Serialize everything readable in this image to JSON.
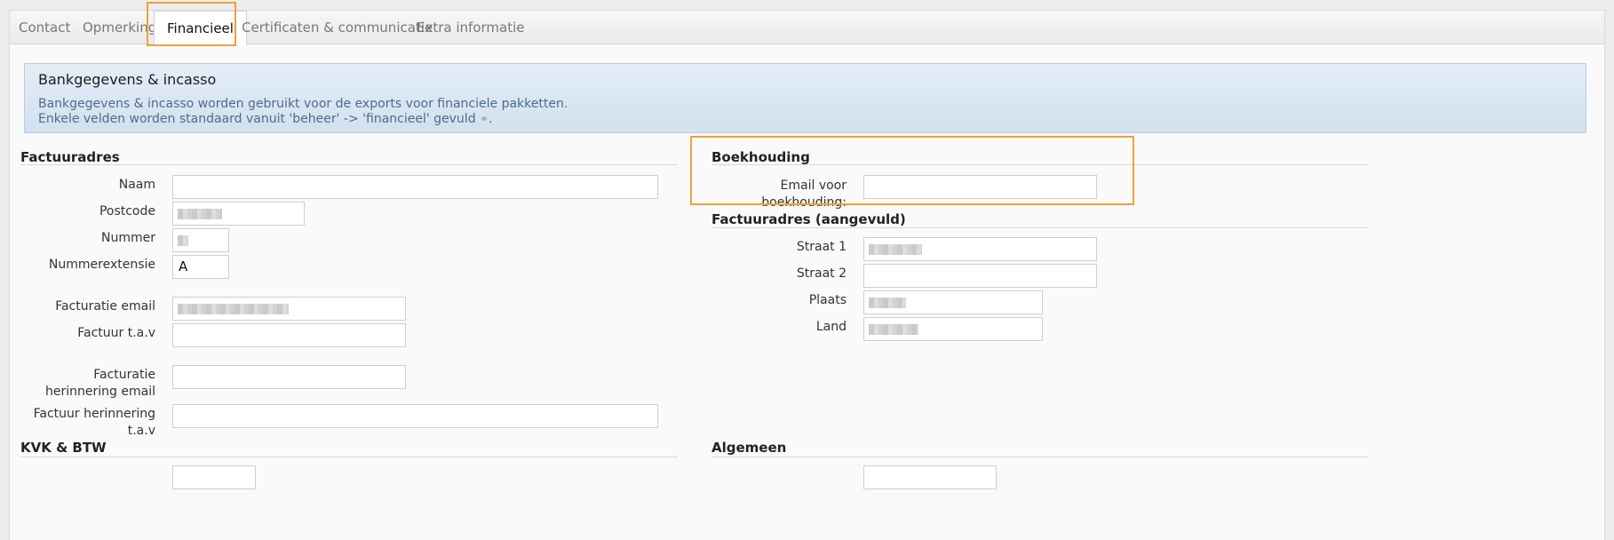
{
  "tabs": [
    {
      "label": "Contact",
      "active": false
    },
    {
      "label": "Opmerking",
      "active": false
    },
    {
      "label": "Financieel",
      "active": true
    },
    {
      "label": "Certificaten & communicatie",
      "active": false
    },
    {
      "label": "Extra informatie",
      "active": false
    }
  ],
  "info": {
    "title": "Bankgegevens & incasso",
    "line1": "Bankgegevens & incasso worden gebruikt voor de exports voor financiele pakketten.",
    "line2": "Enkele velden worden standaard vanuit 'beheer' -> 'financieel' gevuld",
    "line2_end": ".",
    "link_icon": "link-icon"
  },
  "factuuradres": {
    "title": "Factuuradres",
    "naam_label": "Naam",
    "postcode_label": "Postcode",
    "nummer_label": "Nummer",
    "nummerextensie_label": "Nummerextensie",
    "nummerextensie_value": "A",
    "facturatie_email_label": "Facturatie email",
    "factuur_tav_label": "Factuur t.a.v",
    "herinnering_email_label": "Facturatie herinnering email",
    "herinnering_tav_label": "Factuur herinnering t.a.v"
  },
  "boekhouding": {
    "title": "Boekhouding",
    "email_label": "Email voor boekhouding:"
  },
  "factuuradres_aangevuld": {
    "title": "Factuuradres (aangevuld)",
    "straat1_label": "Straat 1",
    "straat2_label": "Straat 2",
    "plaats_label": "Plaats",
    "land_label": "Land"
  },
  "kvk": {
    "title": "KVK & BTW"
  },
  "algemeen": {
    "title": "Algemeen"
  },
  "colors": {
    "highlight": "#f0a03c",
    "info_bg": "#dbe7f3",
    "info_text": "#4b6b8f"
  }
}
